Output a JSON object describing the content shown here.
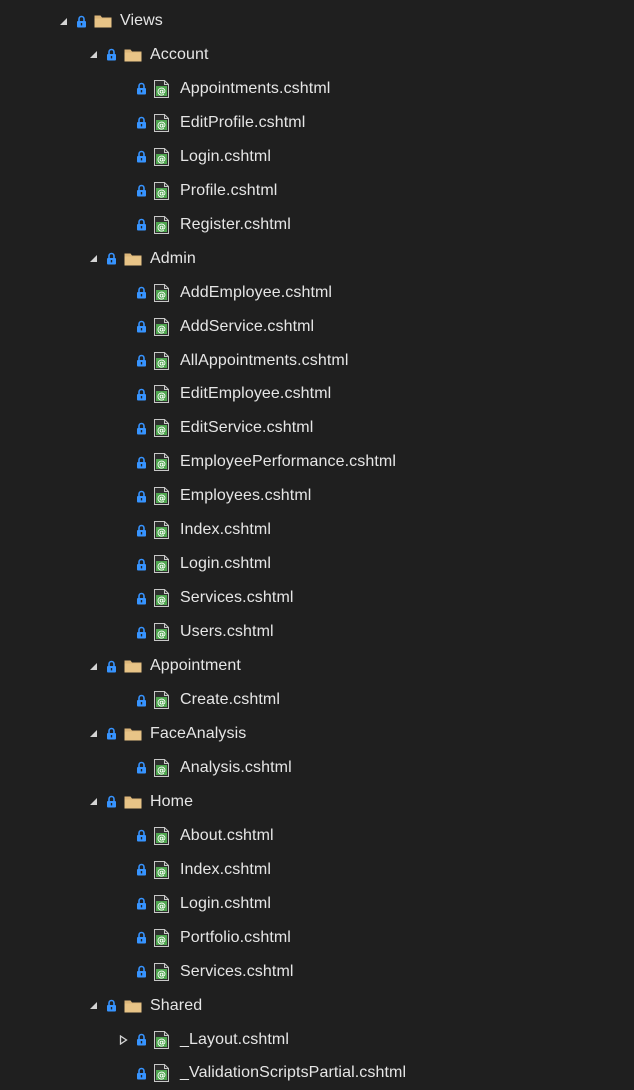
{
  "tree": [
    {
      "label": "Views",
      "type": "folder",
      "depth": 0,
      "state": "expanded"
    },
    {
      "label": "Account",
      "type": "folder",
      "depth": 1,
      "state": "expanded"
    },
    {
      "label": "Appointments.cshtml",
      "type": "file",
      "depth": 2,
      "state": "none"
    },
    {
      "label": "EditProfile.cshtml",
      "type": "file",
      "depth": 2,
      "state": "none"
    },
    {
      "label": "Login.cshtml",
      "type": "file",
      "depth": 2,
      "state": "none"
    },
    {
      "label": "Profile.cshtml",
      "type": "file",
      "depth": 2,
      "state": "none"
    },
    {
      "label": "Register.cshtml",
      "type": "file",
      "depth": 2,
      "state": "none"
    },
    {
      "label": "Admin",
      "type": "folder",
      "depth": 1,
      "state": "expanded"
    },
    {
      "label": "AddEmployee.cshtml",
      "type": "file",
      "depth": 2,
      "state": "none"
    },
    {
      "label": "AddService.cshtml",
      "type": "file",
      "depth": 2,
      "state": "none"
    },
    {
      "label": "AllAppointments.cshtml",
      "type": "file",
      "depth": 2,
      "state": "none"
    },
    {
      "label": "EditEmployee.cshtml",
      "type": "file",
      "depth": 2,
      "state": "none"
    },
    {
      "label": "EditService.cshtml",
      "type": "file",
      "depth": 2,
      "state": "none"
    },
    {
      "label": "EmployeePerformance.cshtml",
      "type": "file",
      "depth": 2,
      "state": "none"
    },
    {
      "label": "Employees.cshtml",
      "type": "file",
      "depth": 2,
      "state": "none"
    },
    {
      "label": "Index.cshtml",
      "type": "file",
      "depth": 2,
      "state": "none"
    },
    {
      "label": "Login.cshtml",
      "type": "file",
      "depth": 2,
      "state": "none"
    },
    {
      "label": "Services.cshtml",
      "type": "file",
      "depth": 2,
      "state": "none"
    },
    {
      "label": "Users.cshtml",
      "type": "file",
      "depth": 2,
      "state": "none"
    },
    {
      "label": "Appointment",
      "type": "folder",
      "depth": 1,
      "state": "expanded"
    },
    {
      "label": "Create.cshtml",
      "type": "file",
      "depth": 2,
      "state": "none"
    },
    {
      "label": "FaceAnalysis",
      "type": "folder",
      "depth": 1,
      "state": "expanded"
    },
    {
      "label": "Analysis.cshtml",
      "type": "file",
      "depth": 2,
      "state": "none"
    },
    {
      "label": "Home",
      "type": "folder",
      "depth": 1,
      "state": "expanded"
    },
    {
      "label": "About.cshtml",
      "type": "file",
      "depth": 2,
      "state": "none"
    },
    {
      "label": "Index.cshtml",
      "type": "file",
      "depth": 2,
      "state": "none"
    },
    {
      "label": "Login.cshtml",
      "type": "file",
      "depth": 2,
      "state": "none"
    },
    {
      "label": "Portfolio.cshtml",
      "type": "file",
      "depth": 2,
      "state": "none"
    },
    {
      "label": "Services.cshtml",
      "type": "file",
      "depth": 2,
      "state": "none"
    },
    {
      "label": "Shared",
      "type": "folder",
      "depth": 1,
      "state": "expanded"
    },
    {
      "label": "_Layout.cshtml",
      "type": "file",
      "depth": 2,
      "state": "collapsed"
    },
    {
      "label": "_ValidationScriptsPartial.cshtml",
      "type": "file",
      "depth": 2,
      "state": "none"
    }
  ],
  "icons": {
    "expanded": "expanded-chevron-icon",
    "collapsed": "collapsed-chevron-icon",
    "lock": "lock-icon",
    "folder": "folder-icon",
    "file": "razor-file-icon"
  },
  "colors": {
    "background": "#1f1f1f",
    "text": "#e6e6e6",
    "folder": "#dcb67a",
    "lock": "#3794ff",
    "razor": "#4fa64f"
  }
}
